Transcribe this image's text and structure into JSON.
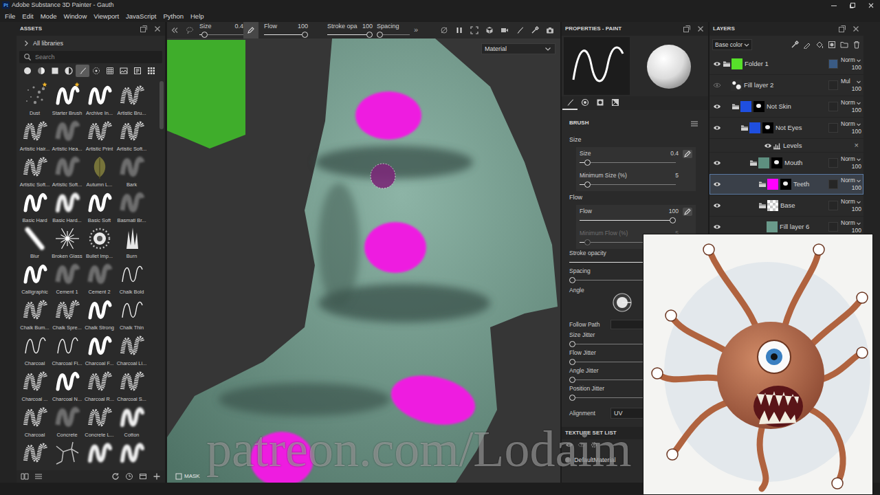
{
  "window": {
    "app_icon": "Pt",
    "title": "Adobe Substance 3D Painter - Gauth"
  },
  "menu": [
    "File",
    "Edit",
    "Mode",
    "Window",
    "Viewport",
    "JavaScript",
    "Python",
    "Help"
  ],
  "assets": {
    "title": "ASSETS",
    "library": "All libraries",
    "search": {
      "placeholder": "Search"
    },
    "filters": [
      {
        "kind": "material",
        "selected": false
      },
      {
        "kind": "smart-material",
        "selected": false
      },
      {
        "kind": "texture",
        "selected": false
      },
      {
        "kind": "mask",
        "selected": false
      },
      {
        "kind": "brush",
        "selected": true
      },
      {
        "kind": "particle",
        "selected": false
      },
      {
        "kind": "pattern",
        "selected": false
      },
      {
        "kind": "environment",
        "selected": false
      },
      {
        "kind": "text",
        "selected": false
      },
      {
        "kind": "all",
        "selected": false
      }
    ],
    "brushes": [
      {
        "label": "Dust",
        "kind": "dust",
        "favorite": true
      },
      {
        "label": "Starter Brush",
        "kind": "hard",
        "favorite": true
      },
      {
        "label": "Archive In...",
        "kind": "hard",
        "favorite": false
      },
      {
        "label": "Artistic Bru...",
        "kind": "textured",
        "favorite": false
      },
      {
        "label": "Artistic Hair...",
        "kind": "textured",
        "favorite": false
      },
      {
        "label": "Artistic Hea...",
        "kind": "faint",
        "favorite": false
      },
      {
        "label": "Artistic Print",
        "kind": "textured",
        "favorite": false
      },
      {
        "label": "Artistic Soft...",
        "kind": "textured",
        "favorite": false
      },
      {
        "label": "Artistic Soft...",
        "kind": "textured",
        "favorite": false
      },
      {
        "label": "Artistic Soft...",
        "kind": "faint",
        "favorite": false
      },
      {
        "label": "Autumn L...",
        "kind": "leaf",
        "favorite": false
      },
      {
        "label": "Bark",
        "kind": "faint",
        "favorite": false
      },
      {
        "label": "Basic Hard",
        "kind": "hard",
        "favorite": false
      },
      {
        "label": "Basic Hard...",
        "kind": "soft",
        "favorite": false
      },
      {
        "label": "Basic Soft",
        "kind": "hard",
        "favorite": false
      },
      {
        "label": "Basmati Br...",
        "kind": "faint",
        "favorite": false
      },
      {
        "label": "Blur",
        "kind": "streak",
        "favorite": false
      },
      {
        "label": "Broken Glass",
        "kind": "spark",
        "favorite": false
      },
      {
        "label": "Bullet Imp...",
        "kind": "splat",
        "favorite": false
      },
      {
        "label": "Burn",
        "kind": "flame",
        "favorite": false
      },
      {
        "label": "Calligraphic",
        "kind": "hard",
        "favorite": false
      },
      {
        "label": "Cement 1",
        "kind": "faint",
        "favorite": false
      },
      {
        "label": "Cement 2",
        "kind": "faint",
        "favorite": false
      },
      {
        "label": "Chalk Bold",
        "kind": "line",
        "favorite": false
      },
      {
        "label": "Chalk Bum...",
        "kind": "textured",
        "favorite": false
      },
      {
        "label": "Chalk Spre...",
        "kind": "textured",
        "favorite": false
      },
      {
        "label": "Chalk Strong",
        "kind": "hard",
        "favorite": false
      },
      {
        "label": "Chalk Thin",
        "kind": "line",
        "favorite": false
      },
      {
        "label": "Charcoal",
        "kind": "line",
        "favorite": false
      },
      {
        "label": "Charcoal Fi...",
        "kind": "line",
        "favorite": false
      },
      {
        "label": "Charcoal F...",
        "kind": "hard",
        "favorite": false
      },
      {
        "label": "Charcoal Li...",
        "kind": "textured",
        "favorite": false
      },
      {
        "label": "Charcoal ...",
        "kind": "textured",
        "favorite": false
      },
      {
        "label": "Charcoal N...",
        "kind": "hard",
        "favorite": false
      },
      {
        "label": "Charcoal R...",
        "kind": "textured",
        "favorite": false
      },
      {
        "label": "Charcoal S...",
        "kind": "textured",
        "favorite": false
      },
      {
        "label": "Charcoal",
        "kind": "textured",
        "favorite": false
      },
      {
        "label": "Concrete",
        "kind": "faint",
        "favorite": false
      },
      {
        "label": "Concrete L...",
        "kind": "textured",
        "favorite": false
      },
      {
        "label": "Cotton",
        "kind": "soft",
        "favorite": false
      },
      {
        "kind": "textured",
        "favorite": false
      },
      {
        "kind": "crack",
        "favorite": false
      },
      {
        "kind": "soft",
        "favorite": false
      },
      {
        "kind": "soft",
        "favorite": false
      }
    ]
  },
  "toolbar": {
    "params": [
      {
        "label": "Size",
        "value": "0.4",
        "level": 0.05
      },
      {
        "label": "Flow",
        "value": "100",
        "level": 1
      },
      {
        "label": "Stroke opa",
        "value": "100",
        "level": 1
      },
      {
        "label": "Spacing",
        "level": 0
      }
    ],
    "more": "»"
  },
  "viewport": {
    "mode": "Material",
    "mask_label": "MASK",
    "watermark": "patreon.com/Lodaim"
  },
  "properties": {
    "title": "PROPERTIES - PAINT",
    "tabs": [
      {
        "kind": "brush",
        "selected": true
      },
      {
        "kind": "material",
        "selected": false
      },
      {
        "kind": "alpha",
        "selected": false
      },
      {
        "kind": "stencil",
        "selected": false
      }
    ],
    "section": "BRUSH",
    "rows": [
      {
        "kind": "section",
        "label": "Size",
        "grouped": false
      },
      {
        "kind": "slider",
        "label": "Size",
        "value": "0.4",
        "level": 0.05,
        "pen": true,
        "disabled": false,
        "grouped": true
      },
      {
        "kind": "slider",
        "label": "Minimum Size (%)",
        "value": "5",
        "level": 0.05,
        "disabled": false,
        "grouped": true
      },
      {
        "kind": "section",
        "label": "Flow",
        "grouped": false
      },
      {
        "kind": "slider",
        "label": "Flow",
        "value": "100",
        "level": 1,
        "pen": true,
        "disabled": false,
        "grouped": true
      },
      {
        "kind": "slider",
        "label": "Minimum Flow (%)",
        "value": "5",
        "level": 0.05,
        "disabled": true,
        "grouped": true
      },
      {
        "kind": "slider",
        "label": "Stroke opacity",
        "level": 1,
        "disabled": false,
        "grouped": false
      },
      {
        "kind": "slider",
        "label": "Spacing",
        "level": 0,
        "disabled": false,
        "grouped": false
      },
      {
        "kind": "dial",
        "label": "Angle",
        "grouped": false
      },
      {
        "kind": "toggle",
        "label": "Follow Path",
        "on": false,
        "grouped": false
      },
      {
        "kind": "slider",
        "label": "Size Jitter",
        "level": 0,
        "disabled": false,
        "grouped": false
      },
      {
        "kind": "slider",
        "label": "Flow Jitter",
        "level": 0,
        "disabled": false,
        "grouped": false
      },
      {
        "kind": "slider",
        "label": "Angle Jitter",
        "level": 0,
        "disabled": false,
        "grouped": false
      },
      {
        "kind": "slider",
        "label": "Position Jitter",
        "level": 0,
        "disabled": false,
        "grouped": false
      },
      {
        "kind": "dropdown",
        "label": "Alignment",
        "value": "UV",
        "grouped": false
      }
    ],
    "texture_set": {
      "title": "TEXTURE SET LIST",
      "items": [
        "DefaultMaterial"
      ]
    }
  },
  "layers": {
    "title": "LAYERS",
    "channel": "Base color",
    "items": [
      {
        "name": "Folder 1",
        "kind": "folder",
        "depth": 0,
        "visible": true,
        "thumb": "color",
        "color": "#57e02a",
        "mask": false,
        "swatch": "#3a5b84",
        "blend": "Norm",
        "opacity": "100",
        "selected": false
      },
      {
        "name": "Fill layer 2",
        "kind": "fill",
        "depth": 1,
        "visible": false,
        "thumb": "texture",
        "mask": false,
        "blend": "Mul",
        "opacity": "100",
        "selected": false
      },
      {
        "name": "Not Skin",
        "kind": "folder",
        "depth": 1,
        "visible": true,
        "thumb": "color",
        "color": "#1f4fe0",
        "mask": true,
        "blend": "Norm",
        "opacity": "100",
        "selected": false
      },
      {
        "name": "Not Eyes",
        "kind": "folder",
        "depth": 2,
        "visible": true,
        "thumb": "color",
        "color": "#1f4fe0",
        "mask": true,
        "blend": "Norm",
        "opacity": "100",
        "selected": false
      },
      {
        "name": "Levels",
        "kind": "effect",
        "depth": 5,
        "visible": true,
        "close": "×",
        "selected": false
      },
      {
        "name": "Mouth",
        "kind": "folder",
        "depth": 3,
        "visible": true,
        "thumb": "color",
        "color": "#5e8f80",
        "mask": true,
        "blend": "Norm",
        "opacity": "100",
        "selected": false
      },
      {
        "name": "Teeth",
        "kind": "folder",
        "depth": 4,
        "visible": true,
        "thumb": "color",
        "color": "#ff00ff",
        "mask": true,
        "blend": "Norm",
        "opacity": "100",
        "selected": true
      },
      {
        "name": "Base",
        "kind": "folder",
        "depth": 4,
        "visible": true,
        "thumb": "checker",
        "mask": false,
        "blend": "Norm",
        "opacity": "100",
        "selected": false
      },
      {
        "name": "Fill layer 6",
        "kind": "fill",
        "depth": 5,
        "visible": true,
        "thumb": "color",
        "color": "#6a9a8b",
        "mask": false,
        "blend": "Norm",
        "opacity": "100",
        "selected": false
      }
    ]
  }
}
